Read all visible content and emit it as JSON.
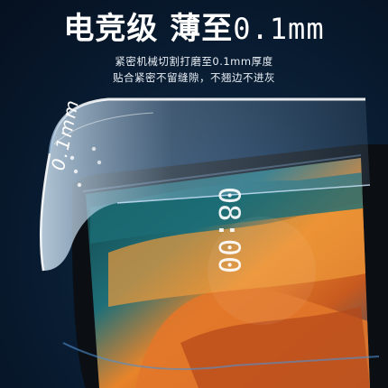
{
  "headline": {
    "part1": "电竞级 薄至",
    "part2": "0.1mm"
  },
  "subtitle": {
    "line1": "紧密机械切割打磨至0.1mm厚度",
    "line2": "贴合紧密不留缝隙，不翘边不进灰"
  },
  "film_label": "0.1mm",
  "phone_clock": "08:00",
  "colors": {
    "background": "#0a1f36",
    "text": "#ffffff",
    "wallpaper_orange": "#e8842a",
    "wallpaper_teal": "#1f6f78"
  }
}
